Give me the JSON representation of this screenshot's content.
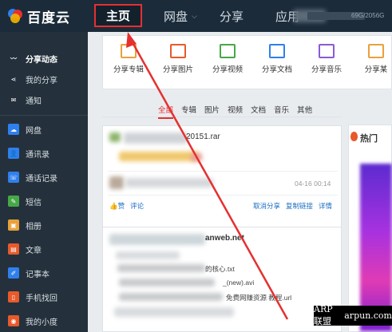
{
  "topbar": {
    "logo_text": "百度云",
    "nav": [
      {
        "label": "主页"
      },
      {
        "label": "网盘"
      },
      {
        "label": "分享"
      },
      {
        "label": "应用"
      }
    ],
    "quota_text": "69G/2056G"
  },
  "sidebar": {
    "items": [
      {
        "label": "分享动态",
        "icon": "activity-icon",
        "color": "#24313c"
      },
      {
        "label": "我的分享",
        "icon": "share-icon",
        "color": "#24313c"
      },
      {
        "label": "通知",
        "icon": "mail-icon",
        "color": "#24313c"
      },
      {
        "label": "网盘",
        "icon": "cloud-icon",
        "color": "#2f80ed"
      },
      {
        "label": "通讯录",
        "icon": "contacts-icon",
        "color": "#2f80ed"
      },
      {
        "label": "通话记录",
        "icon": "call-log-icon",
        "color": "#2f80ed"
      },
      {
        "label": "短信",
        "icon": "sms-icon",
        "color": "#47a847"
      },
      {
        "label": "相册",
        "icon": "photo-icon",
        "color": "#e9a13b"
      },
      {
        "label": "文章",
        "icon": "article-icon",
        "color": "#e85a2b"
      },
      {
        "label": "记事本",
        "icon": "notepad-icon",
        "color": "#2f80ed"
      },
      {
        "label": "手机找回",
        "icon": "phone-find-icon",
        "color": "#e85a2b"
      },
      {
        "label": "我的小度",
        "icon": "xiaodu-icon",
        "color": "#e85a2b"
      }
    ]
  },
  "share_types": [
    {
      "label": "分享专辑",
      "icon": "album-icon",
      "color": "#e9a13b"
    },
    {
      "label": "分享图片",
      "icon": "picture-icon",
      "color": "#e85a2b"
    },
    {
      "label": "分享视频",
      "icon": "video-icon",
      "color": "#47a847"
    },
    {
      "label": "分享文档",
      "icon": "document-icon",
      "color": "#2f80ed"
    },
    {
      "label": "分享音乐",
      "icon": "music-icon",
      "color": "#8a5ad6"
    },
    {
      "label": "分享某",
      "icon": "more-icon",
      "color": "#e9a13b"
    }
  ],
  "filter_tabs": [
    "全部",
    "专辑",
    "图片",
    "视频",
    "文档",
    "音乐",
    "其他"
  ],
  "feed": {
    "card1": {
      "filename": "20151.rar",
      "date": "04-16 00:14",
      "like": "赞",
      "comment": "评论",
      "cancel_share": "取消分享",
      "copy_link": "复制链接",
      "detail": "详情"
    },
    "card2": {
      "title_suffix": "anweb.net",
      "file1": "的核心.txt",
      "file2": "_(new).avi",
      "file3": "免费网赚资源 教程.url"
    }
  },
  "right_panel": {
    "title": "热门"
  },
  "watermark": {
    "left": "ARP联盟",
    "right": "arpun.com"
  },
  "colors": {
    "accent_red": "#e53030",
    "link_blue": "#1a6dc2",
    "topbar_bg": "#1b2b3a",
    "sidebar_bg": "#24313c"
  }
}
